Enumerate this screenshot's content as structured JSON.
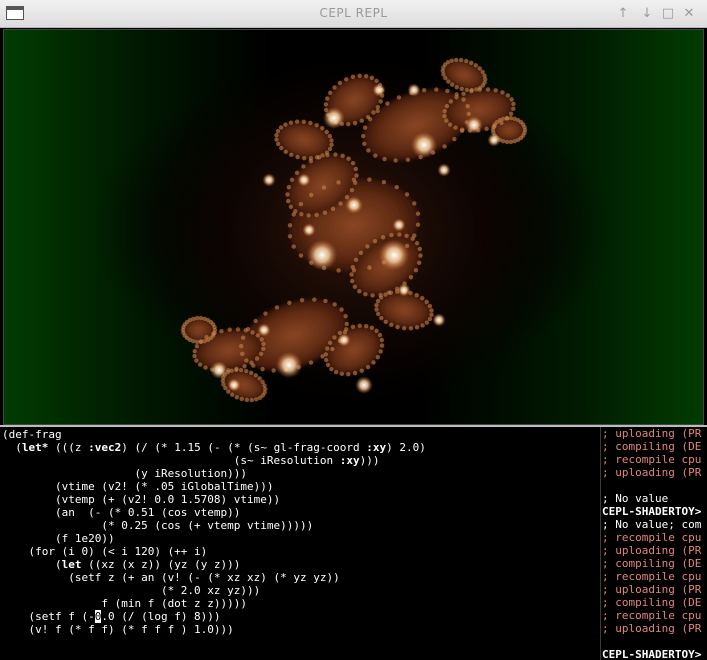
{
  "window": {
    "title": "CEPL REPL",
    "controls": {
      "up": "↑",
      "down": "↓",
      "maximize": "□",
      "close": "✕"
    }
  },
  "editor": {
    "lines": [
      [
        "(def-frag"
      ],
      [
        "  (",
        {
          "kw": "let*"
        },
        " (((z ",
        {
          "kw": ":vec2"
        },
        ") (/ (* 1.15 (- (* (s~ gl-frag-coord ",
        {
          "kw": ":xy"
        },
        ") 2.0)"
      ],
      [
        "                                   (s~ iResolution ",
        {
          "kw": ":xy"
        },
        ")))"
      ],
      [
        "                    (y iResolution)))"
      ],
      [
        "        (vtime (v2! (* .05 iGlobalTime)))"
      ],
      [
        "        (vtemp (+ (v2! 0.0 1.5708) vtime))"
      ],
      [
        "        (an  (- (* 0.51 (cos vtemp))"
      ],
      [
        "               (* 0.25 (cos (+ vtemp vtime)))))"
      ],
      [
        "        (f 1e20))"
      ],
      [
        "    (for (i 0) (< i 120) (++ i)"
      ],
      [
        "        (",
        {
          "kw": "let"
        },
        " ((xz (x z)) (yz (y z)))"
      ],
      [
        "          (setf z (+ an (v! (- (* xz xz) (* yz yz))"
      ],
      [
        "                        (* 2.0 xz yz)))"
      ],
      [
        "               f (min f (dot z z)))))"
      ],
      [
        "    (setf f (-",
        {
          "cursor": "0"
        },
        ".0 (/ (log f) 8)))"
      ],
      [
        "    (v! f (* f f) (* f f f ) 1.0)))"
      ]
    ]
  },
  "repl": {
    "lines": [
      {
        "text": "; uploading (PR",
        "style": "comment"
      },
      {
        "text": "; compiling (DE",
        "style": "comment"
      },
      {
        "text": "; recompile cpu",
        "style": "comment"
      },
      {
        "text": "; uploading (PR",
        "style": "comment"
      },
      {
        "text": "",
        "style": "plain"
      },
      {
        "text": "; No value",
        "style": "plain"
      },
      {
        "text": "CEPL-SHADERTOY>",
        "style": "prompt"
      },
      {
        "text": "; No value; com",
        "style": "plain"
      },
      {
        "text": "; recompile cpu",
        "style": "comment"
      },
      {
        "text": "; uploading (PR",
        "style": "comment"
      },
      {
        "text": "; compiling (DE",
        "style": "comment"
      },
      {
        "text": "; recompile cpu",
        "style": "comment"
      },
      {
        "text": "; uploading (PR",
        "style": "comment"
      },
      {
        "text": "; compiling (DE",
        "style": "comment"
      },
      {
        "text": "; recompile cpu",
        "style": "comment"
      },
      {
        "text": "; uploading (PR",
        "style": "comment"
      },
      {
        "text": "",
        "style": "plain"
      },
      {
        "text": "CEPL-SHADERTOY>",
        "style": "prompt"
      }
    ]
  },
  "colors": {
    "background_green": "#013c01",
    "fractal_core": "#6a2e14",
    "fractal_glow": "#fff0d8",
    "comment": "#e0857a"
  }
}
